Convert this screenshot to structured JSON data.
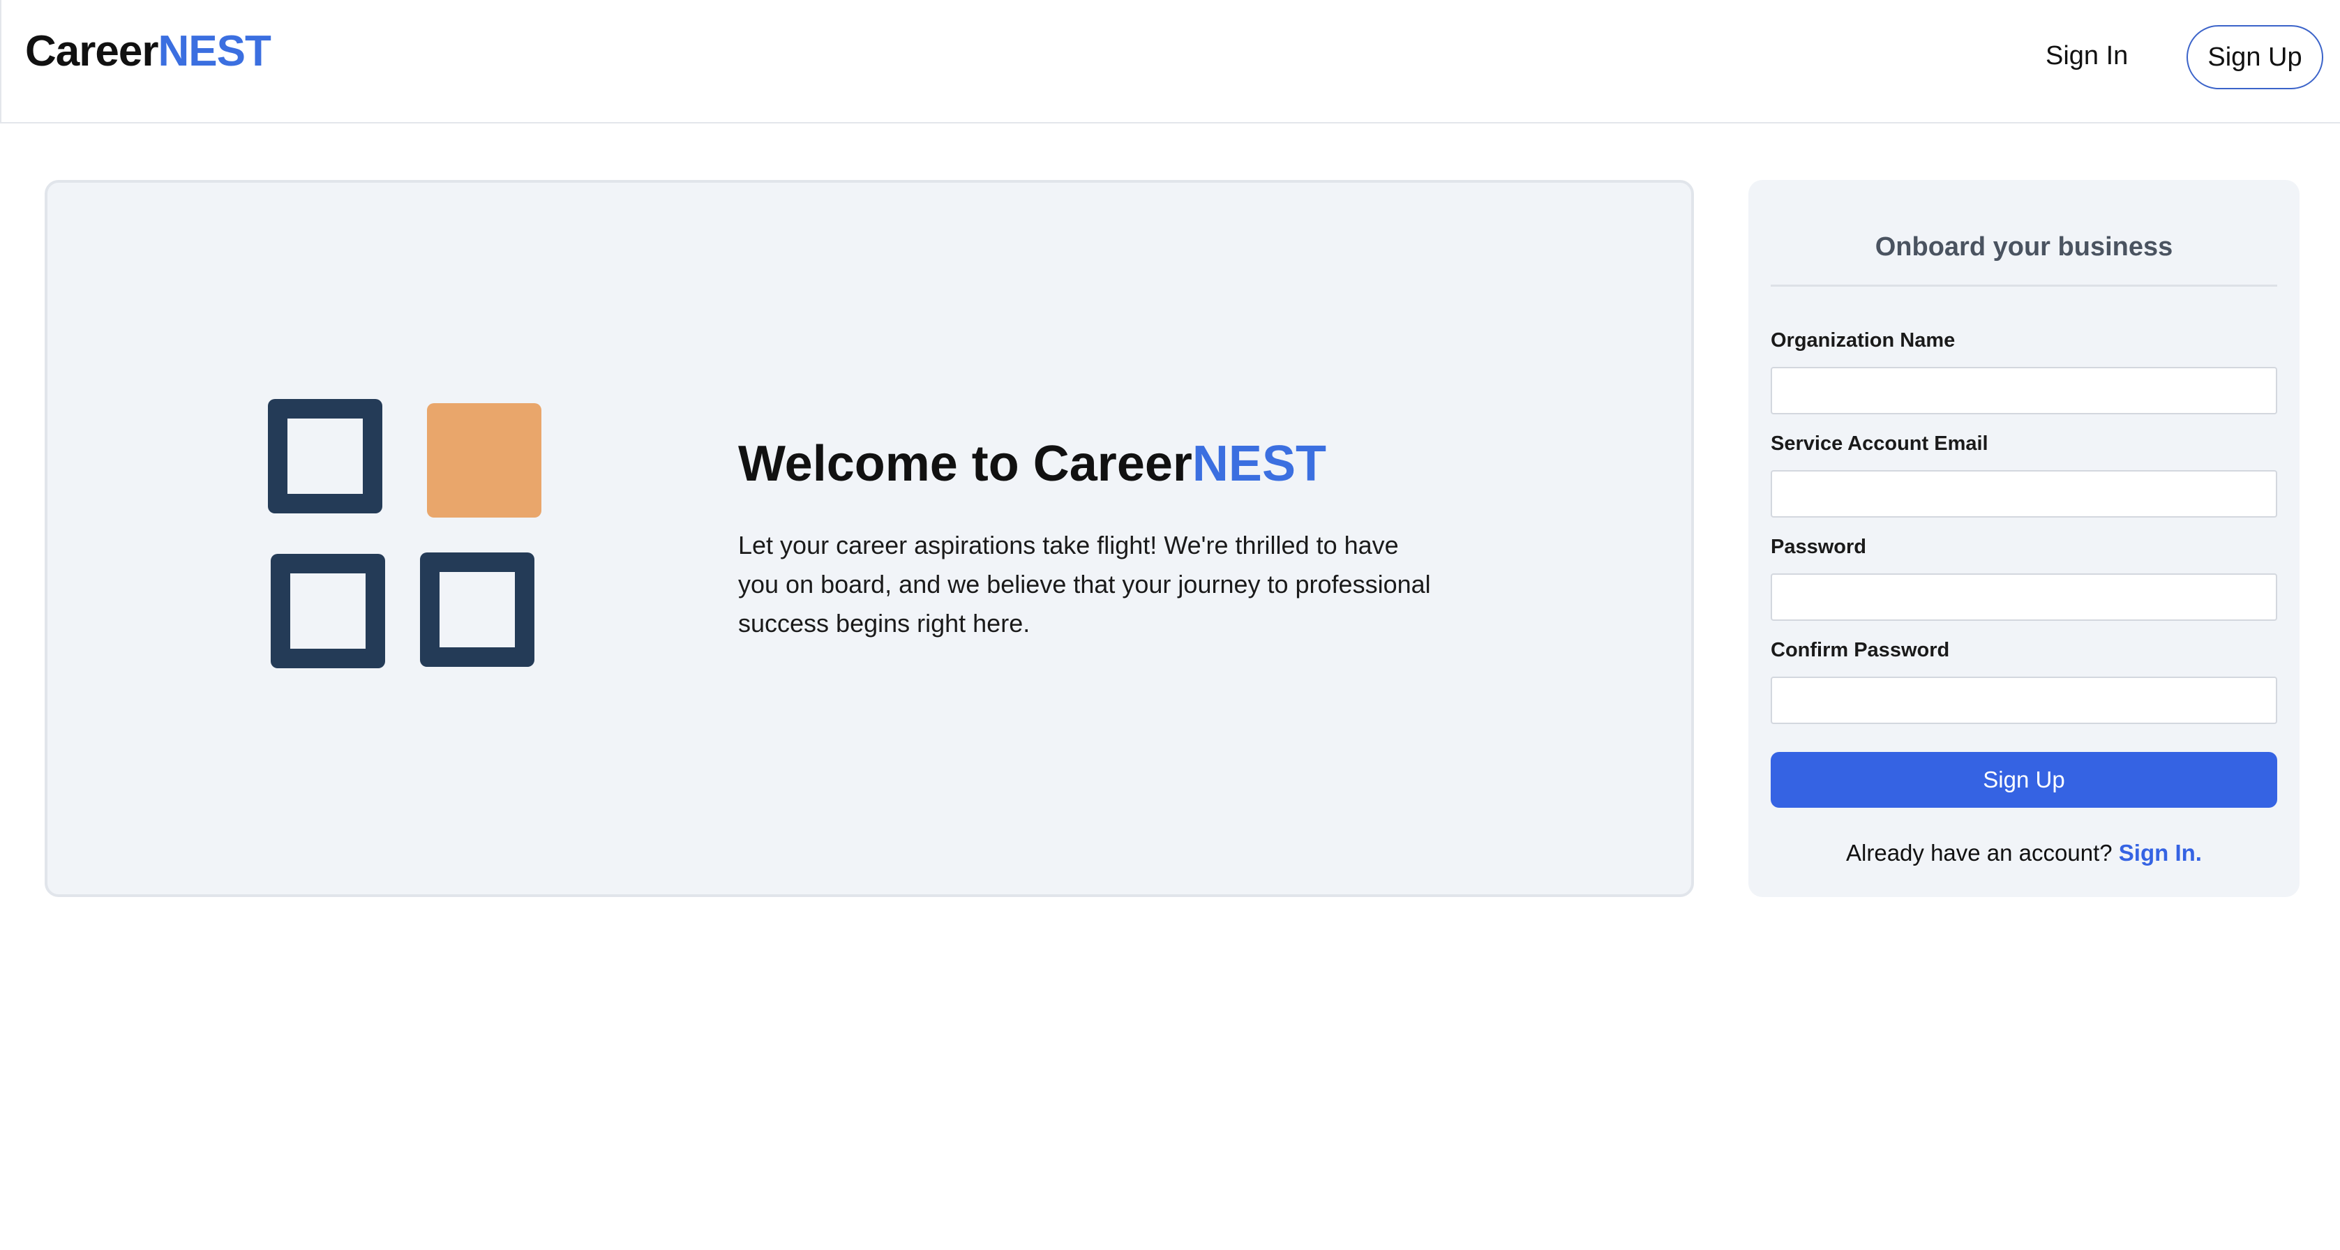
{
  "header": {
    "logo_primary": "Career",
    "logo_accent": "NEST",
    "signin_label": "Sign In",
    "signup_label": "Sign Up"
  },
  "welcome": {
    "title_prefix": "Welcome to Career",
    "title_accent": "NEST",
    "body": "Let your career aspirations take flight! We're thrilled to have you on board, and we believe that your journey to professional success begins right here."
  },
  "form": {
    "title": "Onboard your business",
    "fields": [
      {
        "label": "Organization Name",
        "value": ""
      },
      {
        "label": "Service Account Email",
        "value": ""
      },
      {
        "label": "Password",
        "value": ""
      },
      {
        "label": "Confirm Password",
        "value": ""
      }
    ],
    "submit_label": "Sign Up",
    "account_prompt": "Already have an account?",
    "account_link": "Sign In."
  },
  "colors": {
    "accent": "#3b6fe0",
    "button": "#3563e3",
    "logo_dark": "#243b57",
    "logo_orange": "#e9a66b",
    "panel_bg": "#f1f4f8"
  }
}
